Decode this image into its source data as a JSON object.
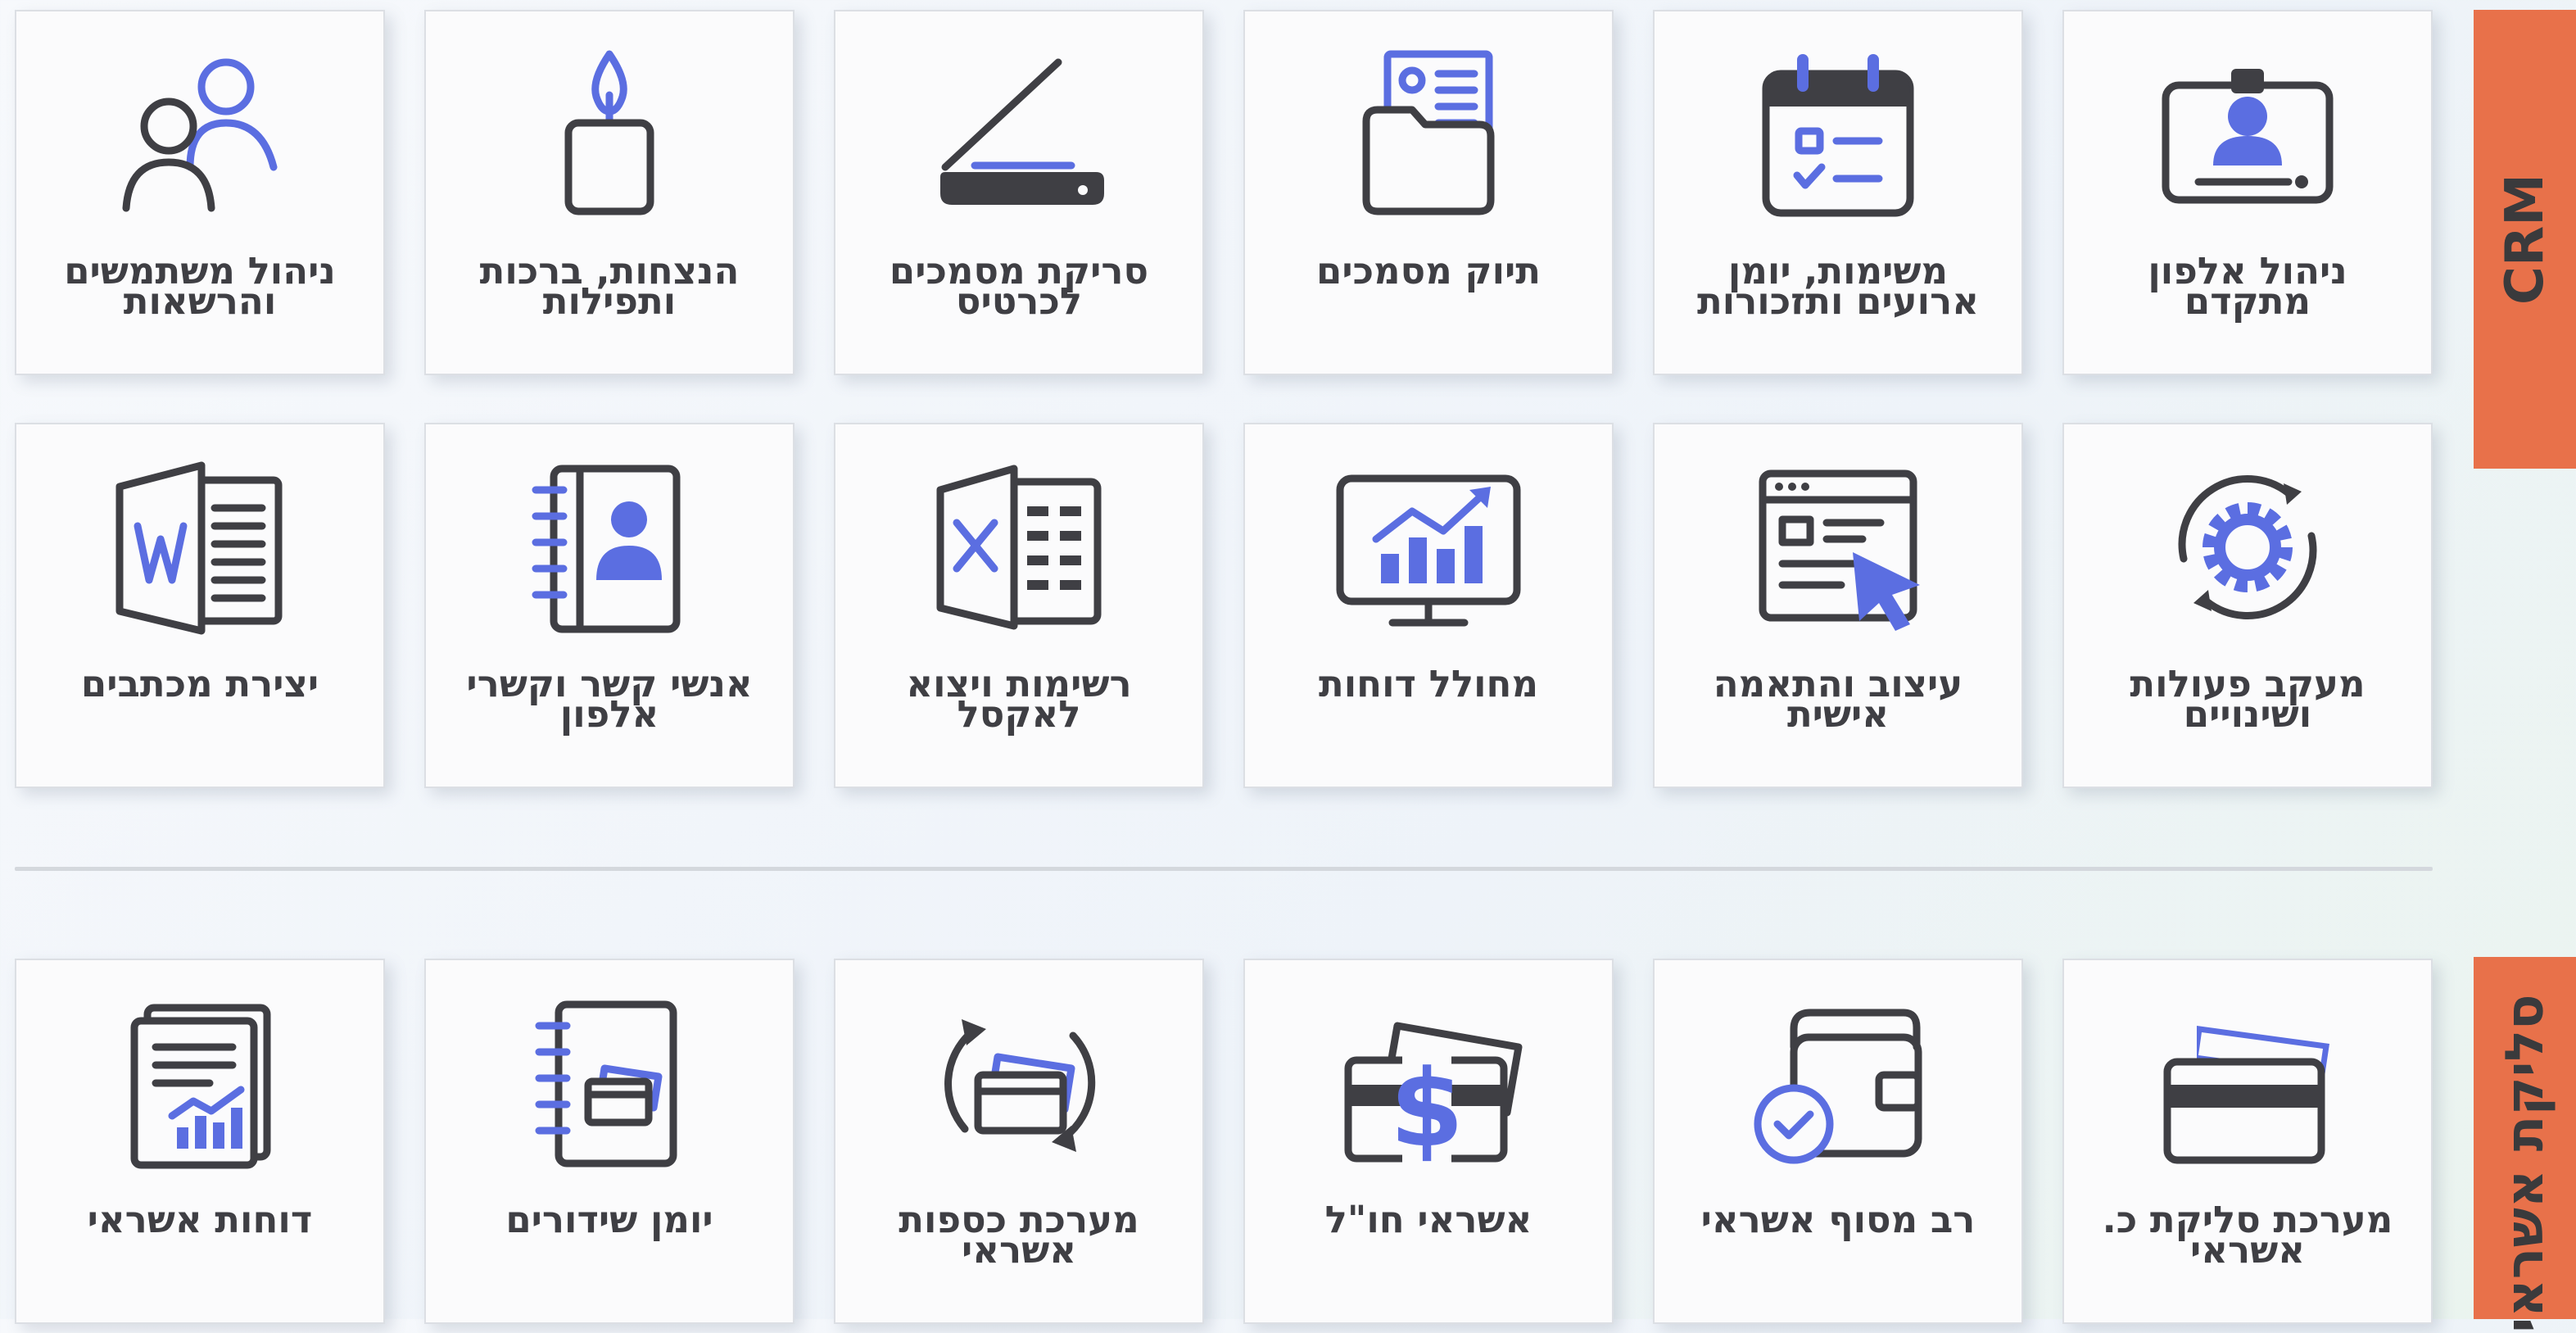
{
  "sections": {
    "crm": {
      "label": "CRM",
      "color": "#e8714a"
    },
    "credit": {
      "label": "סליקת אשראי",
      "color": "#e8714a"
    }
  },
  "crm_row1": [
    {
      "label": "ניהול אלפון\nמתקדם",
      "icon": "id-card-icon"
    },
    {
      "label": "משימות, יומן\nארועים ותזכורות",
      "icon": "calendar-checklist-icon"
    },
    {
      "label": "תיוק מסמכים",
      "icon": "document-folder-icon"
    },
    {
      "label": "סריקת מסמכים\nלכרטיס",
      "icon": "scanner-icon"
    },
    {
      "label": "הנצחות, ברכות\nותפילות",
      "icon": "candle-icon"
    },
    {
      "label": "ניהול משתמשים\nוהרשאות",
      "icon": "users-icon"
    }
  ],
  "crm_row2": [
    {
      "label": "מעקב פעולות\nושינויים",
      "icon": "gear-cycle-icon"
    },
    {
      "label": "עיצוב והתאמה\nאישית",
      "icon": "browser-cursor-icon"
    },
    {
      "label": "מחולל דוחות",
      "icon": "monitor-chart-icon"
    },
    {
      "label": "רשימות ויצוא\nלאקסל",
      "icon": "excel-icon"
    },
    {
      "label": "אנשי קשר וקשרי\nאלפון",
      "icon": "address-book-icon"
    },
    {
      "label": "יצירת מכתבים",
      "icon": "word-icon"
    }
  ],
  "credit_row": [
    {
      "label": "מערכת סליקת כ.\nאשראי",
      "icon": "credit-cards-icon"
    },
    {
      "label": "רב מסוף אשראי",
      "icon": "wallet-check-icon"
    },
    {
      "label": "אשראי חו\"ל",
      "icon": "dollar-cards-icon"
    },
    {
      "label": "מערכת כספות\nאשראי",
      "icon": "card-cycle-icon"
    },
    {
      "label": "יומן שידורים",
      "icon": "card-notebook-icon"
    },
    {
      "label": "דוחות אשראי",
      "icon": "report-document-icon"
    }
  ],
  "colors": {
    "icon_dark": "#3f3f44",
    "icon_accent": "#5b6ee1",
    "tab": "#e8714a"
  }
}
